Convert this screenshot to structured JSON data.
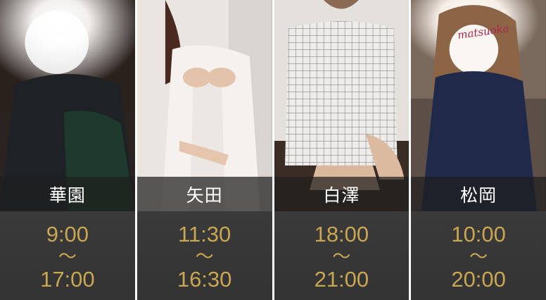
{
  "staff": [
    {
      "name": "華園",
      "start": "9:00",
      "separator": "〜",
      "end": "17:00"
    },
    {
      "name": "矢田",
      "start": "11:30",
      "separator": "〜",
      "end": "16:30"
    },
    {
      "name": "白澤",
      "start": "18:00",
      "separator": "〜",
      "end": "21:00"
    },
    {
      "name": "松岡",
      "start": "10:00",
      "separator": "〜",
      "end": "20:00",
      "watermark": "matsuoka"
    }
  ],
  "colors": {
    "time_text": "#c9a652",
    "name_bar": "#1e1e1e",
    "panel": "#3a3a3a"
  }
}
